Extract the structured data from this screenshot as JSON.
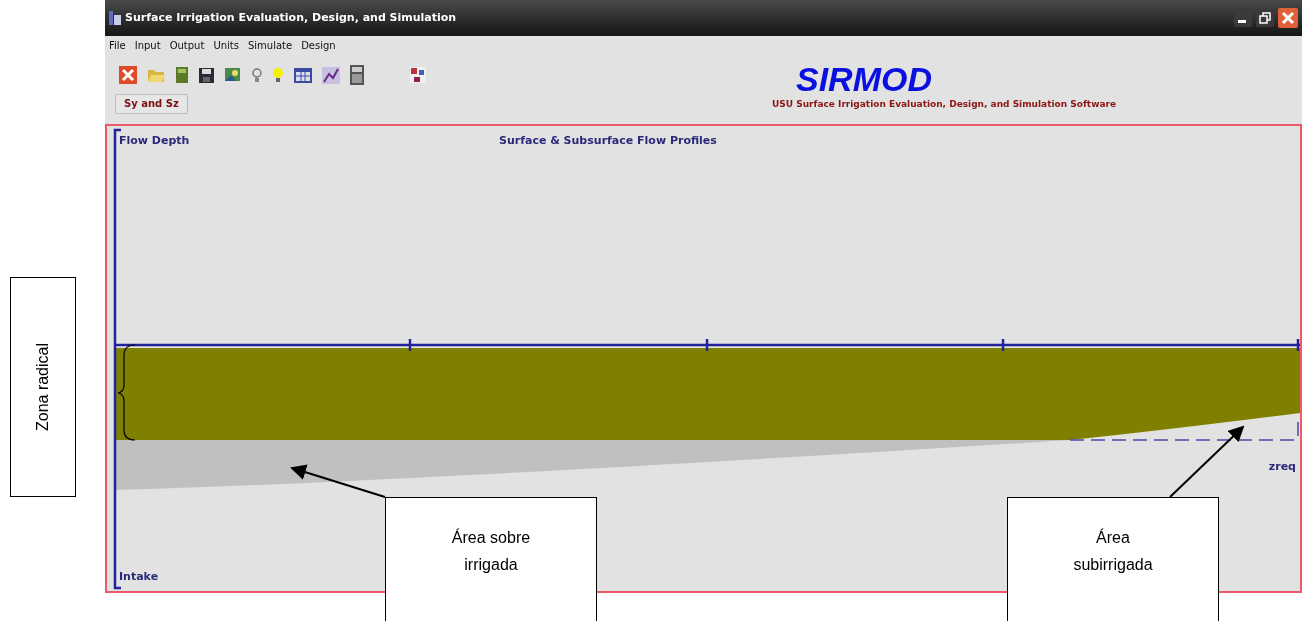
{
  "window": {
    "title": "Surface Irrigation Evaluation, Design, and Simulation"
  },
  "menu": [
    "File",
    "Input",
    "Output",
    "Units",
    "Simulate",
    "Design"
  ],
  "toolbar_button": "Sy and Sz",
  "logo": {
    "title": "SIRMOD",
    "subtitle": "USU Surface Irrigation Evaluation, Design, and Simulation Software"
  },
  "chart": {
    "title": "Surface & Subsurface Flow Profiles",
    "top_label": "Flow Depth",
    "bottom_label": "Intake",
    "line_label": "zreq"
  },
  "annotations": [
    {
      "kind": "vertical",
      "text": "Zona radical"
    },
    {
      "kind": "callout",
      "text": "Área sobre irrigada"
    },
    {
      "kind": "callout",
      "text": "Área subirrigada"
    }
  ]
}
